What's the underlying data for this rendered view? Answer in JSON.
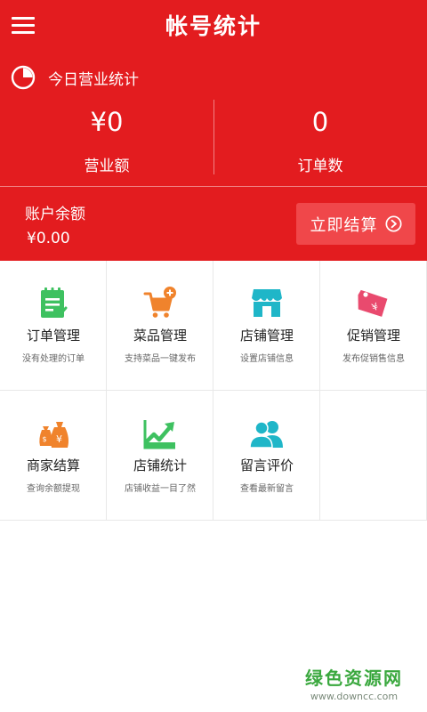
{
  "header": {
    "title": "帐号统计",
    "background": "#e31c1f",
    "today_label": "今日营业统计",
    "stats": {
      "revenue_value": "¥0",
      "revenue_label": "营业额",
      "orders_value": "0",
      "orders_label": "订单数"
    },
    "balance": {
      "label": "账户余额",
      "value": "¥0.00",
      "settle_button": "立即结算"
    }
  },
  "grid": {
    "items": [
      {
        "name": "订单管理",
        "desc": "没有处理的订单",
        "icon": "order-clipboard-icon",
        "color": "#3ec160"
      },
      {
        "name": "菜品管理",
        "desc": "支持菜品一键发布",
        "icon": "shopping-cart-add-icon",
        "color": "#f0832c"
      },
      {
        "name": "店铺管理",
        "desc": "设置店铺信息",
        "icon": "storefront-icon",
        "color": "#1fb6c8"
      },
      {
        "name": "促销管理",
        "desc": "发布促销售信息",
        "icon": "price-tag-icon",
        "color": "#e94a6e"
      },
      {
        "name": "商家结算",
        "desc": "查询余额提现",
        "icon": "money-bag-icon",
        "color": "#f0832c"
      },
      {
        "name": "店铺统计",
        "desc": "店铺收益一目了然",
        "icon": "trend-chart-icon",
        "color": "#3ec160"
      },
      {
        "name": "留言评价",
        "desc": "查看最新留言",
        "icon": "users-icon",
        "color": "#1fb6c8"
      }
    ]
  },
  "watermark": {
    "cn": "绿色资源网",
    "url": "www.downcc.com"
  }
}
